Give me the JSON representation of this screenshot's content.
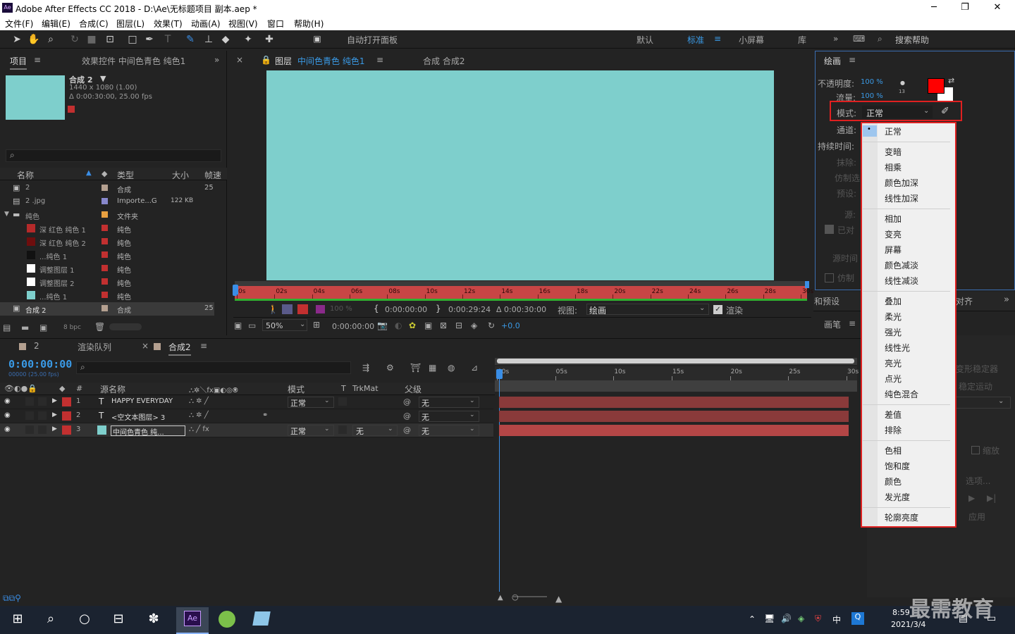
{
  "title": {
    "text": "Adobe After Effects CC 2018 - D:\\Ae\\无标题项目 副本.aep *",
    "ae": "Ae"
  },
  "window": {
    "min": "─",
    "max": "❐",
    "close": "✕"
  },
  "menu": [
    "文件(F)",
    "编辑(E)",
    "合成(C)",
    "图层(L)",
    "效果(T)",
    "动画(A)",
    "视图(V)",
    "窗口",
    "帮助(H)"
  ],
  "toolbar": {
    "auto_open": "自动打开面板",
    "workspaces": [
      "默认",
      "标准",
      "小屏幕",
      "库"
    ],
    "active_ws": "标准",
    "search": "搜索帮助"
  },
  "project": {
    "tab": "项目",
    "effects_tab": "效果控件 中间色青色 纯色1",
    "comp_name": "合成 2",
    "info1": "1440 x 1080 (1.00)",
    "info2": "Δ 0:00:30:00, 25.00 fps",
    "search_icon": "⌕",
    "headers": [
      "名称",
      "类型",
      "大小",
      "帧速"
    ],
    "items": [
      {
        "name": "2",
        "type": "合成",
        "size": "",
        "fps": "25",
        "color": "#b4a090"
      },
      {
        "name": "2 .jpg",
        "type": "Importe...G",
        "size": "122 KB",
        "fps": "",
        "color": "#8888cc"
      },
      {
        "name": "纯色",
        "type": "文件夹",
        "size": "",
        "fps": "",
        "color": "#e8a040"
      },
      {
        "name": "深 红色 纯色 1",
        "type": "纯色",
        "size": "",
        "fps": "",
        "color": "#c23030",
        "sw": "#b52a2a"
      },
      {
        "name": "深 红色 纯色 2",
        "type": "纯色",
        "size": "",
        "fps": "",
        "color": "#c23030",
        "sw": "#6e0e0e"
      },
      {
        "name": "...纯色 1",
        "type": "纯色",
        "size": "",
        "fps": "",
        "color": "#c23030",
        "sw": "#111111"
      },
      {
        "name": "调整图层 1",
        "type": "纯色",
        "size": "",
        "fps": "",
        "color": "#c23030",
        "sw": "#ffffff"
      },
      {
        "name": "调整图层 2",
        "type": "纯色",
        "size": "",
        "fps": "",
        "color": "#c23030",
        "sw": "#ffffff"
      },
      {
        "name": "...纯色 1",
        "type": "纯色",
        "size": "",
        "fps": "",
        "color": "#c23030",
        "sw": "#7ecfcc"
      },
      {
        "name": "合成 2",
        "type": "合成",
        "size": "",
        "fps": "25",
        "color": "#b4a090"
      }
    ],
    "bpc": "8 bpc"
  },
  "viewer": {
    "tab1_prefix": "图层",
    "tab1_name": "中间色青色 纯色1",
    "tab2": "合成 合成2",
    "ticks": [
      "0s",
      "02s",
      "04s",
      "06s",
      "08s",
      "10s",
      "12s",
      "14s",
      "16s",
      "18s",
      "20s",
      "22s",
      "24s",
      "26s",
      "28s",
      "30s"
    ],
    "t_in": "0:00:00:00",
    "t_out": "0:00:29:24",
    "t_dur": "Δ 0:00:30:00",
    "view_label": "视图:",
    "view_value": "绘画",
    "render": "渲染",
    "zoom": "50%",
    "timecode": "0:00:00:00",
    "exposure": "+0.0",
    "opacity": "100 %"
  },
  "paint": {
    "tab": "绘画",
    "opacity_label": "不透明度:",
    "opacity_val": "100 %",
    "flow_label": "流量:",
    "flow_val": "100 %",
    "mode_label": "模式:",
    "mode_value": "正常",
    "channel_label": "通道:",
    "duration_label": "持续时间:",
    "erase": "抹除:",
    "clone": "仿制选",
    "preset": "预设:",
    "source": "源:",
    "aligned": "已对",
    "source_time": "源时间",
    "clone_src": "仿制",
    "brush_size": "13",
    "fg_color": "#ff0000",
    "bg_color": "#ffffff"
  },
  "dropdown": {
    "groups": [
      [
        "正常"
      ],
      [
        "变暗",
        "相乘",
        "颜色加深",
        "线性加深"
      ],
      [
        "相加",
        "变亮",
        "屏幕",
        "颜色减淡",
        "线性减淡"
      ],
      [
        "叠加",
        "柔光",
        "强光",
        "线性光",
        "亮光",
        "点光",
        "纯色混合"
      ],
      [
        "差值",
        "排除"
      ],
      [
        "色相",
        "饱和度",
        "颜色",
        "发光度"
      ],
      [
        "轮廓亮度"
      ]
    ]
  },
  "right": {
    "preset": "和预设",
    "align": "对齐",
    "brush": "画笔",
    "warp": "变形稳定器",
    "stab": "稳定运动",
    "scale": "缩放",
    "options": "选项...",
    "apply": "应用"
  },
  "timeline": {
    "tabs": [
      "2",
      "渲染队列",
      "合成2"
    ],
    "time": "0:00:00:00",
    "sub": "00000 (25.00 fps)",
    "headers": {
      "src": "源名称",
      "mode": "模式",
      "t": "T",
      "trkmat": "TrkMat",
      "parent": "父级"
    },
    "layers": [
      {
        "num": "1",
        "type": "T",
        "name": "HAPPY EVERYDAY",
        "mode": "正常",
        "trk": "",
        "parent": "无",
        "color": "#c23030"
      },
      {
        "num": "2",
        "type": "T",
        "name": "<空文本图层> 3",
        "mode": "",
        "trk": "",
        "parent": "无",
        "color": "#c23030"
      },
      {
        "num": "3",
        "type": "",
        "name": "中间色青色 纯...",
        "mode": "正常",
        "trk": "无",
        "parent": "无",
        "color": "#c23030"
      }
    ],
    "ticks": [
      "00s",
      "05s",
      "10s",
      "15s",
      "20s",
      "25s",
      "30s"
    ]
  },
  "taskbar": {
    "time": "8:59",
    "date": "2021/3/4",
    "ime": "中"
  },
  "watermark": "最需教育"
}
